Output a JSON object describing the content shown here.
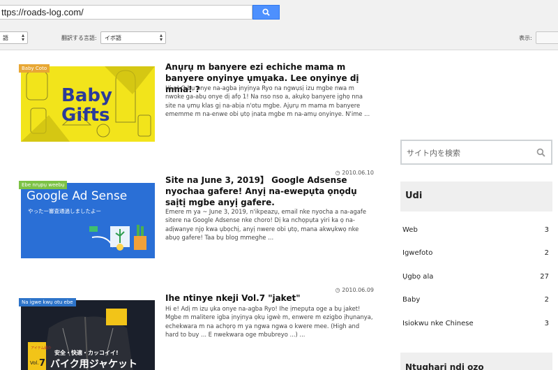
{
  "translate_bar": {
    "url": "ttps://roads-log.com/",
    "from_language": "語",
    "target_language_label": "翻訳する言語:",
    "target_language": "イボ語",
    "display_label": "表示:"
  },
  "posts": [
    {
      "category": "Baby Coto",
      "category_color": "#e8a735",
      "date": "",
      "title": "Anụrụ m banyere ezi echiche mama m banyere onyinye ụmụaka. Lee onyinye dị mma! ?",
      "excerpt": "Hi e! Ọ bụ onye na-agba ịnyịnya Ryo na ngwụsị izu mgbe nwa m nwoke ga-abụ onye dị afọ 1! Na nso nso a, akụkọ banyere ịghọ nna site na ụmụ klas gị na-abịa n'otu mgbe. Ajụrụ m mama m banyere ememme m na-enwe obi ụtọ ịnata mgbe m na-amụ onyinye. N'ime ...",
      "thumb_text": [
        "Baby",
        "Gifts"
      ],
      "thumb_bg": "#f2e41b"
    },
    {
      "category": "Ebe nrụpụ weebụ",
      "category_color": "#7cc245",
      "date": "2010.06.10",
      "title": "Site na June 3, 2019】 Google Adsense nyochaa gafere! Anyị na-ewepụta ọnọdụ saịtị mgbe anyị gafere.",
      "excerpt": "Emere m ya ~ June 3, 2019, n'ikpeazụ, email nke nyocha a na-agafe sitere na Google Adsense nke choro! Dị ka nchọpụta yiri ka ọ na-adịwanye njọ kwa ụbọchị, anyị nwere obi ụtọ, mana akwụkwọ nke abụọ gafere! Taa bụ blog mmeghe ...",
      "thumb_text": [
        "Google Ad Sense",
        "やったー審査通過しましたよー"
      ],
      "thumb_bg": "#2a6fd6"
    },
    {
      "category": "Na igwe kwụ otu ebe",
      "category_color": "#2e74c9",
      "date": "2010.06.09",
      "title": "Ihe ntinye nkeji Vol.7 \"jaket\"",
      "excerpt": "Hi e! Adị m izu ụka onye na-agba Ryo! Ihe ịmepụta oge a bụ jaket! Mgbe m malitere igba ịnyịnya ọkụ igwè m, enwere m ezigbo ịhụnanya, echekwara m na achọrọ m ya ngwa ngwa o kwere mee. (High and hard to buy ... E nwekwara oge mbubreyo ...) ...",
      "thumb_text": [
        "アイテム紹介",
        "Vol.",
        "7",
        "安全・快適・カッコイイ!",
        "バイク用ジャケット"
      ],
      "thumb_bg": "#1a1f2b"
    }
  ],
  "sidebar": {
    "search_placeholder": "サイト内を検索",
    "categories_title": "Udi",
    "categories": [
      {
        "name": "Web",
        "count": "3"
      },
      {
        "name": "Igwefoto",
        "count": "2"
      },
      {
        "name": "Ụgbọ ala",
        "count": "27"
      },
      {
        "name": "Baby",
        "count": "2"
      },
      {
        "name": "Isiokwu nke Chinese",
        "count": "3"
      }
    ],
    "next_widget_title": "Ntụghari ndị ozo"
  },
  "colors": {
    "accent_blue": "#4d90fe",
    "toolbar_bg": "#f1f1f1",
    "widget_bg": "#efefef"
  }
}
